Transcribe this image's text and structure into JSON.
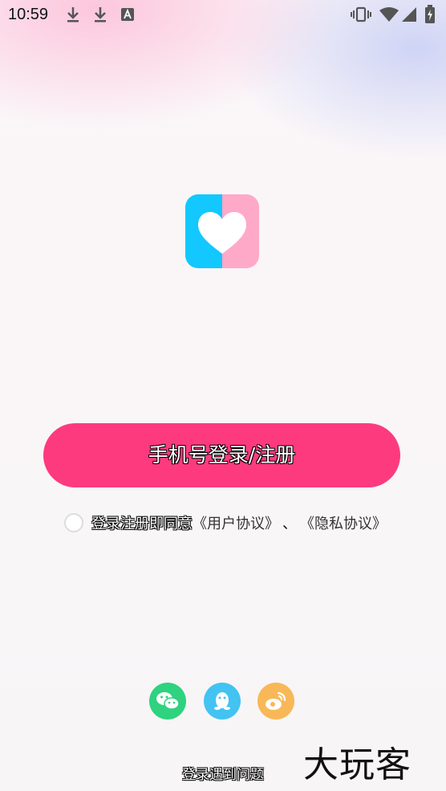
{
  "status_bar": {
    "time": "10:59"
  },
  "app_logo": {
    "left_color": "#12c8ff",
    "right_color": "#ffa9c8",
    "heart_color": "#ffffff"
  },
  "login": {
    "button_label": "手机号登录/注册",
    "button_color": "#fd3a7e"
  },
  "agreement": {
    "text": "登录注册即同意",
    "user_agreement": "《用户协议》",
    "separator": "、",
    "privacy_policy": "《隐私协议》"
  },
  "social_login": {
    "wechat_color": "#2fd27f",
    "qq_color": "#42c3f2",
    "weibo_color": "#f8b857"
  },
  "footer": {
    "problem_link": "登录遇到问题",
    "watermark": "大玩客"
  }
}
